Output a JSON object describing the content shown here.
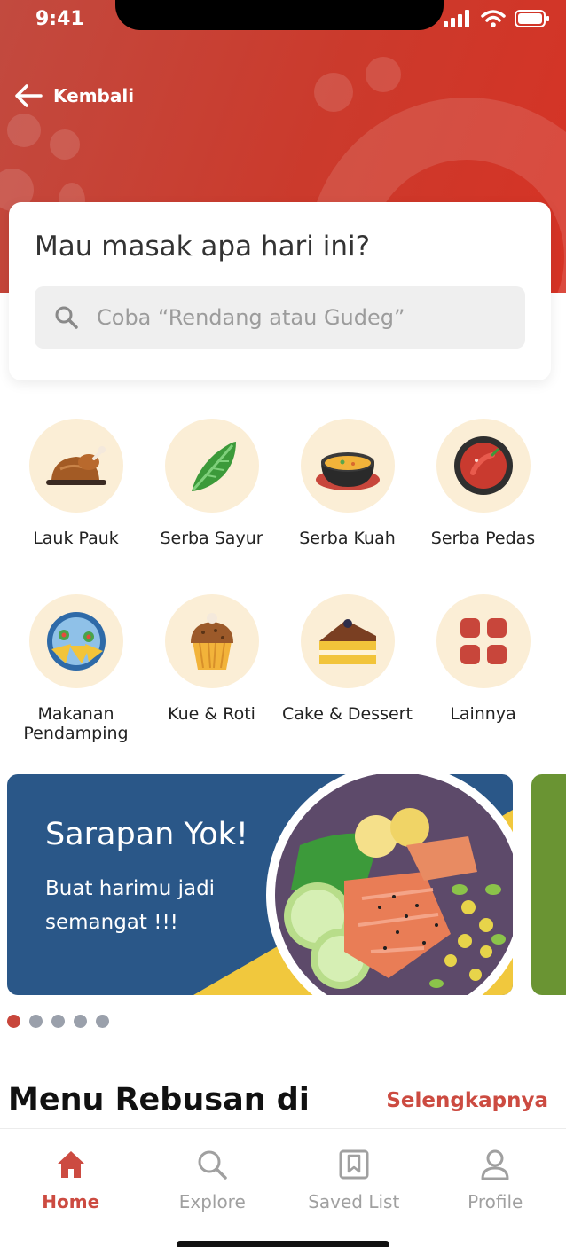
{
  "status_bar": {
    "time": "9:41"
  },
  "header": {
    "back_label": "Kembali"
  },
  "search": {
    "title": "Mau masak apa hari ini?",
    "placeholder": "Coba “Rendang atau Gudeg”"
  },
  "categories": [
    {
      "label": "Lauk Pauk",
      "icon": "roast-chicken-icon"
    },
    {
      "label": "Serba Sayur",
      "icon": "leaf-icon"
    },
    {
      "label": "Serba Kuah",
      "icon": "soup-bowl-icon"
    },
    {
      "label": "Serba Pedas",
      "icon": "chili-icon"
    },
    {
      "label": "Makanan Pendamping",
      "icon": "nachos-icon"
    },
    {
      "label": "Kue & Roti",
      "icon": "muffin-icon"
    },
    {
      "label": "Cake & Dessert",
      "icon": "cake-slice-icon"
    },
    {
      "label": "Lainnya",
      "icon": "grid-icon"
    }
  ],
  "banner": {
    "title": "Sarapan Yok!",
    "subtitle": "Buat harimu jadi semangat !!!",
    "slides_total": 5,
    "active_slide": 1
  },
  "section": {
    "title": "Menu Rebusan di",
    "link": "Selengkapnya"
  },
  "bottom_nav": [
    {
      "label": "Home",
      "icon": "home-icon",
      "active": true
    },
    {
      "label": "Explore",
      "icon": "search-icon",
      "active": false
    },
    {
      "label": "Saved List",
      "icon": "bookmark-icon",
      "active": false
    },
    {
      "label": "Profile",
      "icon": "profile-icon",
      "active": false
    }
  ],
  "colors": {
    "primary": "#cb3a2c",
    "accent_text": "#cc4b41",
    "category_bg": "#fbeed6",
    "banner_bg": "#2a5788",
    "banner_next_bg": "#6a9433"
  }
}
